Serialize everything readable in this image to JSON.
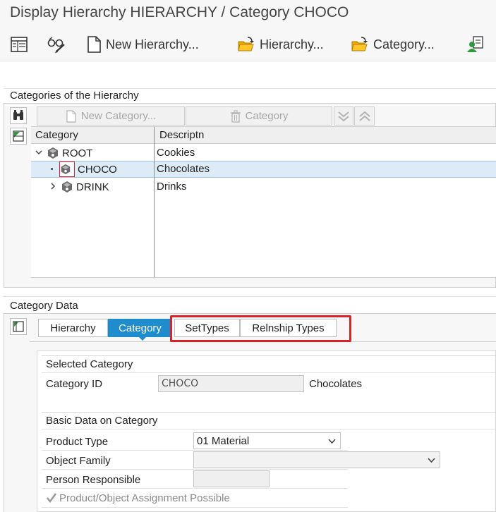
{
  "window": {
    "title": "Display Hierarchy HIERARCHY / Category CHOCO"
  },
  "toolbar": {
    "new_hierarchy": "New Hierarchy...",
    "hierarchy": "Hierarchy...",
    "category": "Category..."
  },
  "tree_panel": {
    "title": "Categories of the Hierarchy",
    "new_category": "New Category...",
    "delete_category": "Category",
    "columns": [
      "Category",
      "Descriptn"
    ],
    "rows": [
      {
        "category": "ROOT",
        "description": "Cookies"
      },
      {
        "category": "CHOCO",
        "description": "Chocolates"
      },
      {
        "category": "DRINK",
        "description": "Drinks"
      }
    ]
  },
  "data_panel": {
    "title": "Category Data",
    "tabs": [
      "Hierarchy",
      "Category",
      "SetTypes",
      "Relnship Types"
    ],
    "active_tab": "Category",
    "selected_group": {
      "title": "Selected Category",
      "category_id_label": "Category ID",
      "category_id_value": "CHOCO",
      "category_desc": "Chocolates"
    },
    "basic_group": {
      "title": "Basic Data on Category",
      "product_type_label": "Product Type",
      "product_type_value": "01 Material",
      "object_family_label": "Object Family",
      "object_family_value": "",
      "person_responsible_label": "Person Responsible",
      "person_responsible_value": "",
      "assignment_label": "Product/Object Assignment Possible",
      "assignment_checked": true
    }
  },
  "colors": {
    "accent": "#1f8ccd",
    "highlight": "#d9232b",
    "selection": "#dcebf5"
  }
}
